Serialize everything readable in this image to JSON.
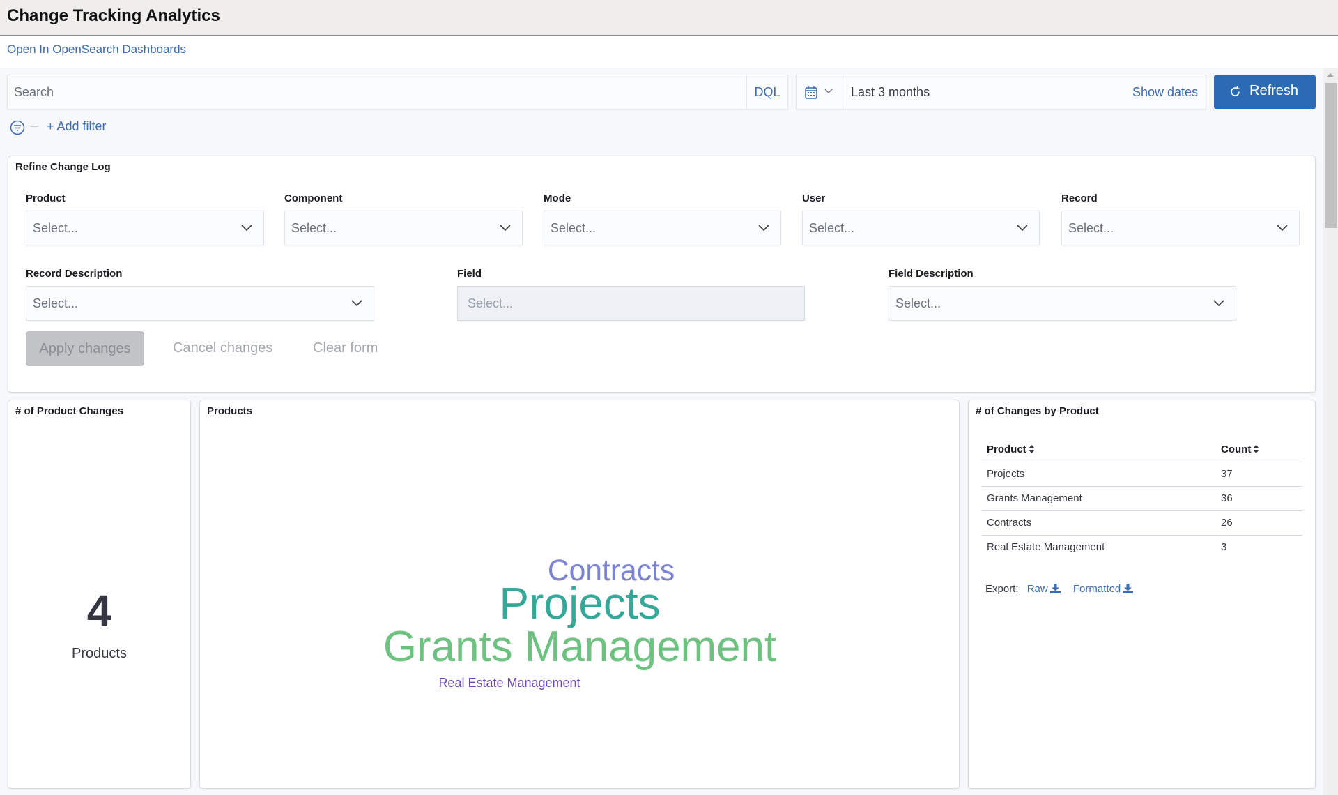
{
  "header": {
    "title": "Change Tracking Analytics"
  },
  "open_link": "Open In OpenSearch Dashboards",
  "query_bar": {
    "search_placeholder": "Search",
    "search_value": "",
    "language": "DQL",
    "date_icon": "calendar-icon",
    "date_range": "Last 3 months",
    "show_dates": "Show dates",
    "refresh_label": "Refresh",
    "refresh_color": "#2b6ab5"
  },
  "filters": {
    "add_filter": "+ Add filter"
  },
  "refine": {
    "title": "Refine Change Log",
    "fields": [
      {
        "label": "Product",
        "placeholder": "Select...",
        "disabled": false
      },
      {
        "label": "Component",
        "placeholder": "Select...",
        "disabled": false
      },
      {
        "label": "Mode",
        "placeholder": "Select...",
        "disabled": false
      },
      {
        "label": "User",
        "placeholder": "Select...",
        "disabled": false
      },
      {
        "label": "Record",
        "placeholder": "Select...",
        "disabled": false
      },
      {
        "label": "Record Description",
        "placeholder": "Select...",
        "disabled": false
      },
      {
        "label": "Field",
        "placeholder": "Select...",
        "disabled": true
      },
      {
        "label": "Field Description",
        "placeholder": "Select...",
        "disabled": false
      }
    ],
    "apply": "Apply changes",
    "cancel": "Cancel changes",
    "clear": "Clear form"
  },
  "metric": {
    "title": "# of Product Changes",
    "value": "4",
    "unit": "Products"
  },
  "word_cloud": {
    "title": "Products",
    "words": [
      {
        "text": "Contracts",
        "weight": 26,
        "color": "#7a83d6"
      },
      {
        "text": "Projects",
        "weight": 37,
        "color": "#36a89a"
      },
      {
        "text": "Grants Management",
        "weight": 36,
        "color": "#6cc380"
      },
      {
        "text": "Real Estate Management",
        "weight": 3,
        "color": "#6b45b9"
      }
    ]
  },
  "table": {
    "title": "# of Changes by Product",
    "columns": [
      "Product",
      "Count"
    ],
    "rows": [
      [
        "Projects",
        "37"
      ],
      [
        "Grants Management",
        "36"
      ],
      [
        "Contracts",
        "26"
      ],
      [
        "Real Estate Management",
        "3"
      ]
    ],
    "export_label": "Export:",
    "export_raw": "Raw",
    "export_formatted": "Formatted"
  }
}
